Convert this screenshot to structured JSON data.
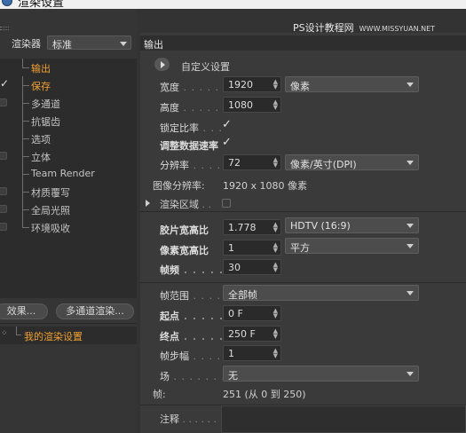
{
  "window": {
    "title": "渲染设置"
  },
  "watermark": {
    "text": "PS设计教程网",
    "url": "WWW.MISSYUAN.NET"
  },
  "renderer": {
    "label": "渲染器",
    "value": "标准"
  },
  "left_items": [
    {
      "label": "输出",
      "active": true,
      "checked": false,
      "has_box": false
    },
    {
      "label": "保存",
      "active": true,
      "checked": true,
      "has_box": false
    },
    {
      "label": "多通道",
      "active": false,
      "checked": false,
      "has_box": true
    },
    {
      "label": "抗锯齿",
      "active": false,
      "checked": false,
      "has_box": false
    },
    {
      "label": "选项",
      "active": false,
      "checked": false,
      "has_box": false
    },
    {
      "label": "立体",
      "active": false,
      "checked": false,
      "has_box": true
    },
    {
      "label": "Team Render",
      "active": false,
      "checked": false,
      "has_box": false
    },
    {
      "label": "材质覆写",
      "active": false,
      "checked": false,
      "has_box": true
    },
    {
      "label": "全局光照",
      "active": false,
      "checked": false,
      "has_box": true
    },
    {
      "label": "环境吸收",
      "active": false,
      "checked": false,
      "has_box": true
    }
  ],
  "buttons": {
    "effects": "效果...",
    "multipass": "多通道渲染..."
  },
  "render_setting": {
    "label": "我的渲染设置"
  },
  "panel": {
    "title": "输出",
    "preset": "自定义设置"
  },
  "output": {
    "width_label": "宽度",
    "width": "1920",
    "unit": "像素",
    "height_label": "高度",
    "height": "1080",
    "lock_ratio_label": "锁定比率",
    "lock_ratio": true,
    "adjust_rate_label": "调整数据速率",
    "adjust_rate": true,
    "resolution_label": "分辨率",
    "resolution": "72",
    "res_unit": "像素/英寸(DPI)",
    "image_res_label": "图像分辨率:",
    "image_res": "1920 x 1080 像素",
    "render_region_label": "渲染区域",
    "render_region": false,
    "film_aspect_label": "胶片宽高比",
    "film_aspect": "1.778",
    "film_aspect_preset": "HDTV (16:9)",
    "pixel_aspect_label": "像素宽高比",
    "pixel_aspect": "1",
    "pixel_aspect_preset": "平方",
    "fps_label": "帧频",
    "fps": "30",
    "frame_range_label": "帧范围",
    "frame_range": "全部帧",
    "start_label": "起点",
    "start": "0 F",
    "end_label": "终点",
    "end": "250 F",
    "step_label": "帧步幅",
    "step": "1",
    "field_label": "场",
    "field": "无",
    "frames_label": "帧:",
    "frames": "251 (从 0 到 250)",
    "notes_label": "注释"
  }
}
